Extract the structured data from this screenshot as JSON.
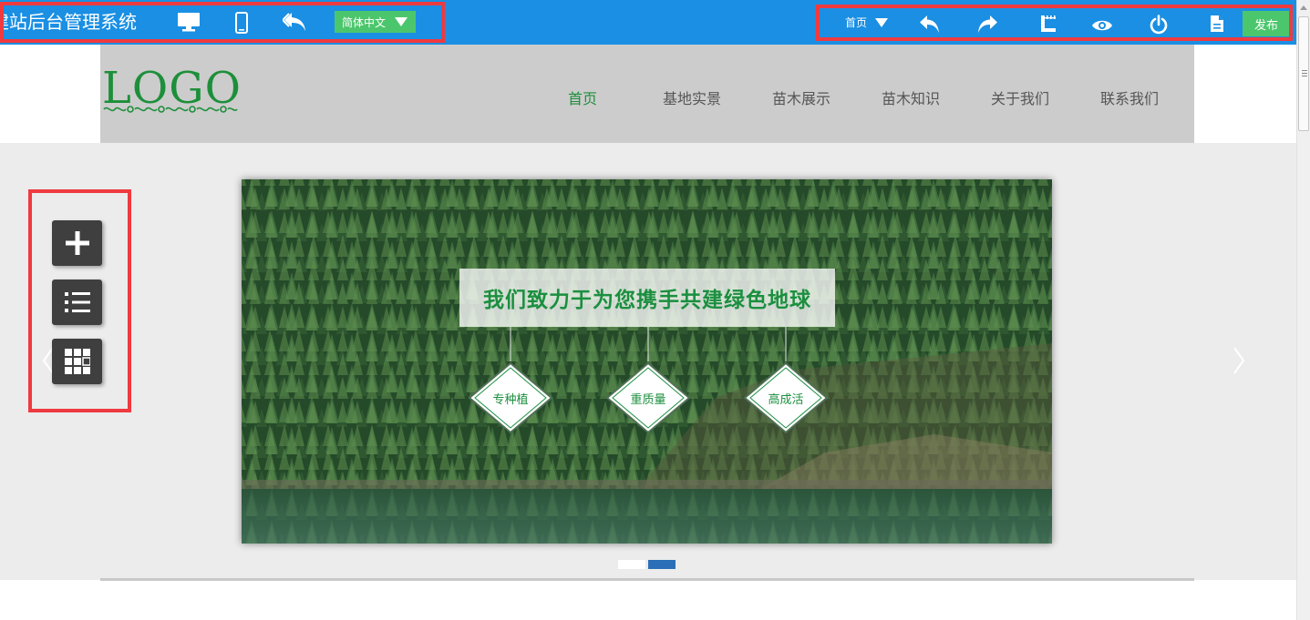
{
  "toolbar": {
    "brand": "建站后台管理系统",
    "language": "简体中文",
    "current_page": "首页",
    "publish_label": "发布",
    "icons": [
      "desktop-icon",
      "mobile-icon",
      "back-icon",
      "undo-icon",
      "redo-icon",
      "ruler-icon",
      "preview-icon",
      "power-icon",
      "document-icon"
    ]
  },
  "site": {
    "logo": "LOGO",
    "nav": [
      {
        "label": "首页",
        "active": true
      },
      {
        "label": "基地实景",
        "active": false
      },
      {
        "label": "苗木展示",
        "active": false
      },
      {
        "label": "苗木知识",
        "active": false
      },
      {
        "label": "关于我们",
        "active": false
      },
      {
        "label": "联系我们",
        "active": false
      }
    ]
  },
  "banner": {
    "slogan": "我们致力于为您携手共建绿色地球",
    "badges": [
      "专种植",
      "重质量",
      "高成活"
    ],
    "slides_total": 2,
    "active_slide": 2
  },
  "side_tools": [
    "add-icon",
    "list-icon",
    "grid-icon"
  ],
  "colors": {
    "toolbar": "#1a8fe3",
    "accent_green": "#4cc66c",
    "brand_green": "#1d8f3a",
    "highlight_red": "#ef3a3f",
    "active_dot": "#2a6fb8"
  }
}
